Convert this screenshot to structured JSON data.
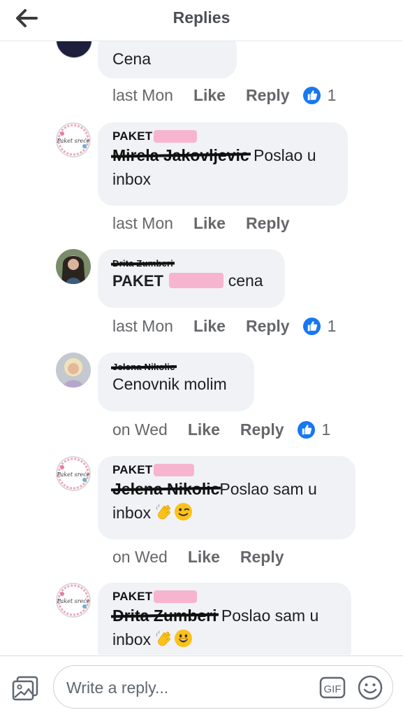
{
  "header": {
    "title": "Replies"
  },
  "comments": [
    {
      "text": "Cena",
      "time": "last Mon",
      "like": "Like",
      "reply": "Reply",
      "reactions": "1"
    },
    {
      "author": "PAKET",
      "mention": "Mirela Jakovljevic",
      "text": " Poslao u",
      "text2": "inbox",
      "time": "last Mon",
      "like": "Like",
      "reply": "Reply"
    },
    {
      "author": "Drita Zumberi",
      "prefix": "PAKET",
      "suffix": " cena",
      "time": "last Mon",
      "like": "Like",
      "reply": "Reply",
      "reactions": "1"
    },
    {
      "author": "Jelena Nikolic",
      "text": "Cenovnik molim",
      "time": "on Wed",
      "like": "Like",
      "reply": "Reply",
      "reactions": "1"
    },
    {
      "author": "PAKET",
      "mention": "Jelena Nikolic",
      "text": "Poslao sam u",
      "text2": "inbox",
      "time": "on Wed",
      "like": "Like",
      "reply": "Reply"
    },
    {
      "author": "PAKET",
      "mention": "Drita Zumberi",
      "text": " Poslao sam u",
      "text2": "inbox"
    }
  ],
  "page_avatar_text": "Paket sreće",
  "composer": {
    "placeholder": "Write a reply...",
    "gif_label": "GIF"
  },
  "colors": {
    "like_blue": "#1877f2",
    "redaction_pink": "#f7b5cd",
    "bubble": "#f0f2f5",
    "meta": "#65676b"
  },
  "icons": [
    "back-arrow-icon",
    "like-reaction-icon",
    "waving-hand-emoji",
    "winking-face-emoji",
    "grinning-face-emoji",
    "photo-icon",
    "gif-icon",
    "smiley-icon"
  ]
}
